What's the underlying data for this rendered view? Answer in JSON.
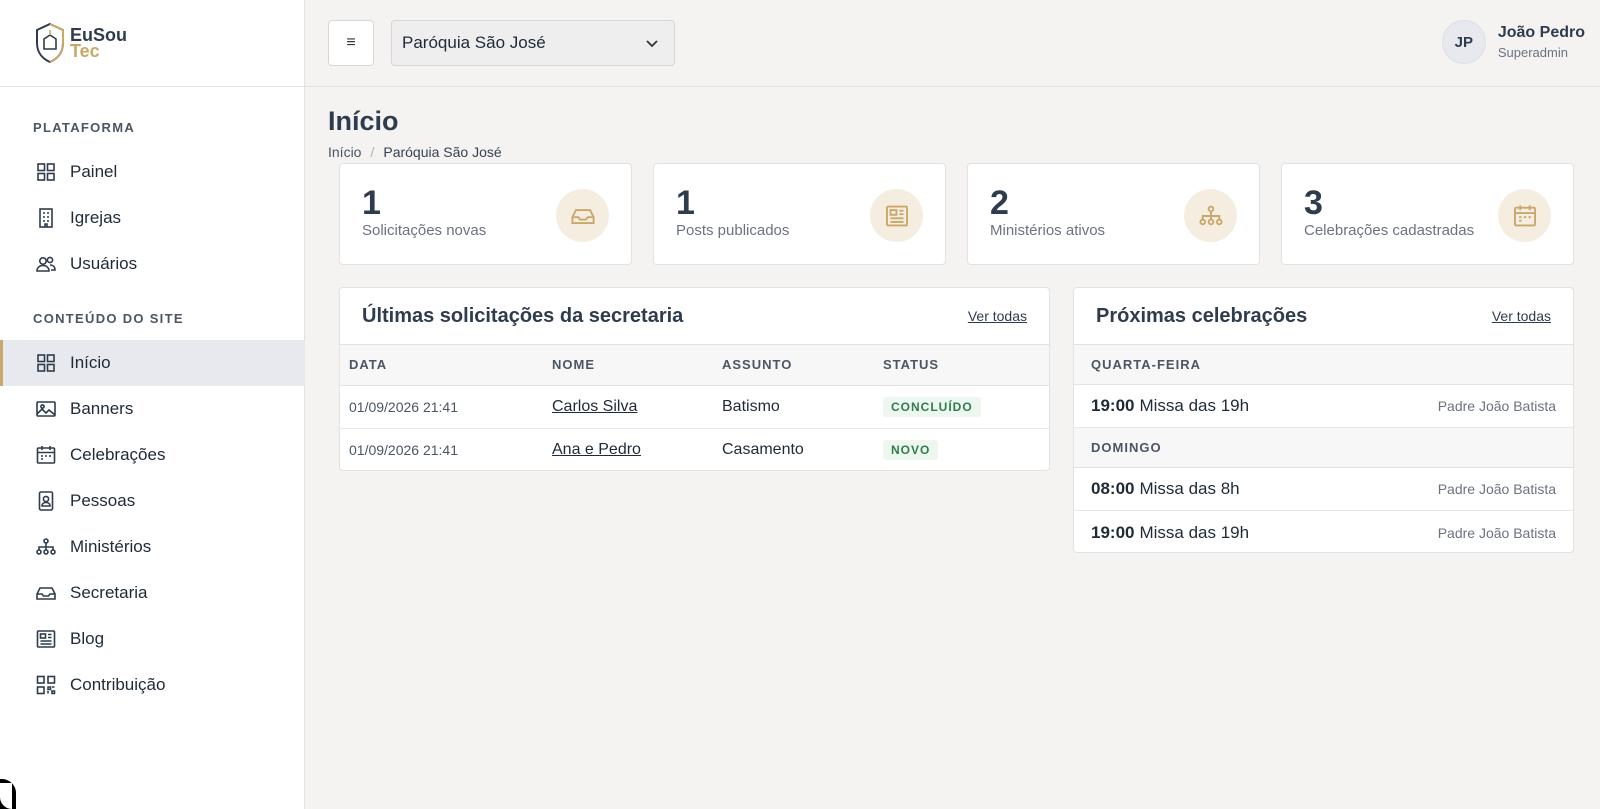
{
  "brand": {
    "line1": "EuSou",
    "line2": "Tec"
  },
  "topbar": {
    "menu_symbol": "≡",
    "parish_selected": "Paróquia São José",
    "user_initials": "JP",
    "user_name": "João Pedro",
    "user_role": "Superadmin"
  },
  "sidebar": {
    "section_platform": "PLATAFORMA",
    "platform_items": [
      {
        "label": "Painel",
        "icon": "grid-icon"
      },
      {
        "label": "Igrejas",
        "icon": "building-icon"
      },
      {
        "label": "Usuários",
        "icon": "users-icon"
      }
    ],
    "section_content": "CONTEÚDO DO SITE",
    "content_items": [
      {
        "label": "Início",
        "icon": "grid-icon",
        "active": true
      },
      {
        "label": "Banners",
        "icon": "image-icon"
      },
      {
        "label": "Celebrações",
        "icon": "calendar-icon"
      },
      {
        "label": "Pessoas",
        "icon": "person-badge-icon"
      },
      {
        "label": "Ministérios",
        "icon": "org-chart-icon"
      },
      {
        "label": "Secretaria",
        "icon": "inbox-icon"
      },
      {
        "label": "Blog",
        "icon": "newspaper-icon"
      },
      {
        "label": "Contribuição",
        "icon": "qr-code-icon"
      }
    ]
  },
  "page": {
    "title": "Início",
    "breadcrumb": [
      "Início",
      "/",
      "Paróquia São José"
    ]
  },
  "stats": [
    {
      "value": "1",
      "label": "Solicitações novas",
      "icon": "inbox-icon"
    },
    {
      "value": "1",
      "label": "Posts publicados",
      "icon": "newspaper-icon"
    },
    {
      "value": "2",
      "label": "Ministérios ativos",
      "icon": "org-chart-icon"
    },
    {
      "value": "3",
      "label": "Celebrações cadastradas",
      "icon": "calendar-icon"
    }
  ],
  "requests": {
    "title": "Últimas solicitações da secretaria",
    "link": "Ver todas",
    "columns": [
      "DATA",
      "NOME",
      "ASSUNTO",
      "STATUS"
    ],
    "rows": [
      {
        "date": "01/09/2026 21:41",
        "name": "Carlos Silva",
        "subject": "Batismo",
        "status": "CONCLUÍDO"
      },
      {
        "date": "01/09/2026 21:41",
        "name": "Ana e Pedro",
        "subject": "Casamento",
        "status": "NOVO"
      }
    ]
  },
  "celebrations": {
    "title": "Próximas celebrações",
    "link": "Ver todas",
    "groups": [
      {
        "day": "QUARTA-FEIRA",
        "items": [
          {
            "time": "19:00",
            "name": "Missa das 19h",
            "priest": "Padre João Batista"
          }
        ]
      },
      {
        "day": "DOMINGO",
        "items": [
          {
            "time": "08:00",
            "name": "Missa das 8h",
            "priest": "Padre João Batista"
          },
          {
            "time": "19:00",
            "name": "Missa das 19h",
            "priest": "Padre João Batista"
          }
        ]
      }
    ]
  },
  "colors": {
    "accent": "#c9a86b",
    "navy": "#2f3c4d",
    "status_green": "#2e7d4f"
  }
}
